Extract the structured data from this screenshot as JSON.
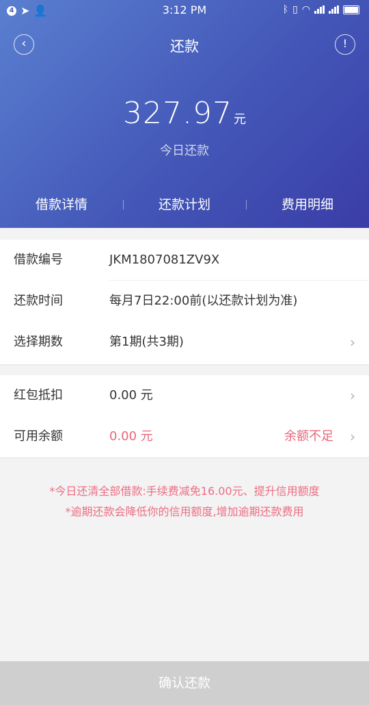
{
  "status": {
    "badge": "4",
    "time": "3:12 PM"
  },
  "header": {
    "title": "还款",
    "amount": "327.97",
    "unit": "元",
    "amount_label": "今日还款"
  },
  "tabs": [
    {
      "label": "借款详情"
    },
    {
      "label": "还款计划"
    },
    {
      "label": "费用明细"
    }
  ],
  "details": {
    "loan_no_label": "借款编号",
    "loan_no": "JKM1807081ZV9X",
    "time_label": "还款时间",
    "time_value": "每月7日22:00前(以还款计划为准)",
    "period_label": "选择期数",
    "period_value": "第1期(共3期)"
  },
  "deduction": {
    "redpacket_label": "红包抵扣",
    "redpacket_value": "0.00 元",
    "balance_label": "可用余额",
    "balance_value": "0.00 元",
    "balance_warning": "余额不足"
  },
  "notes": [
    "*今日还清全部借款:手续费减免16.00元、提升信用额度",
    "*逾期还款会降低你的信用额度,增加逾期还款费用"
  ],
  "confirm_label": "确认还款",
  "colors": {
    "accent_gradient_start": "#5a7fd0",
    "accent_gradient_end": "#3a3da6",
    "warning_pink": "#e8667a",
    "disabled_button": "#cfcfcf"
  }
}
